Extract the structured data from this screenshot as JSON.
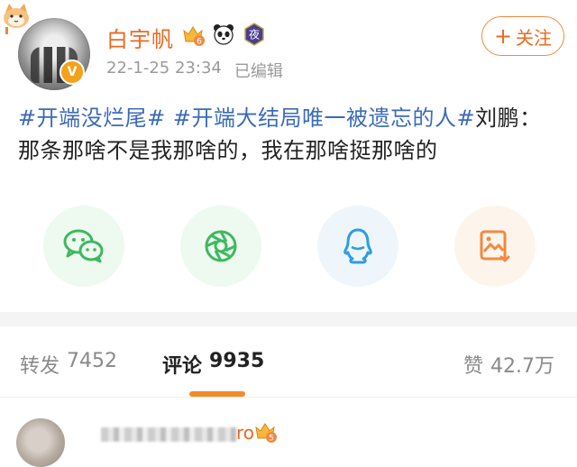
{
  "post": {
    "author": {
      "name": "白宇帆",
      "verified_glyph": "V",
      "badges": [
        {
          "icon": "crown-level-6-icon",
          "level": "6"
        },
        {
          "icon": "panda-icon"
        },
        {
          "icon": "night-badge-icon",
          "text": "夜"
        }
      ]
    },
    "timestamp": "22-1-25 23:34",
    "edited_label": "已编辑",
    "follow": {
      "plus": "+",
      "label": "关注"
    },
    "content": {
      "topic_1": "#开端没烂尾#",
      "topic_2": "#开端大结局唯一被遗忘的人#",
      "body": "刘鹏：那条那啥不是我那啥的，我在那啥挺那啥的"
    }
  },
  "share_buttons": [
    {
      "icon": "wechat-icon",
      "color": "#3fb860"
    },
    {
      "icon": "moments-icon",
      "color": "#3fb860"
    },
    {
      "icon": "qq-icon",
      "color": "#2d9ee0"
    },
    {
      "icon": "save-image-icon",
      "color": "#f08a3f"
    }
  ],
  "stats": {
    "repost": {
      "label": "转发",
      "count": "7452"
    },
    "comment": {
      "label": "评论",
      "count": "9935"
    },
    "like": {
      "label": "赞",
      "count": "42.7万"
    }
  },
  "comment_preview": {
    "name_tail": "ro",
    "crown_level": "5"
  },
  "colors": {
    "accent": "#ea6a20",
    "topic": "#3b6bb8",
    "muted": "#9a9a9a"
  }
}
